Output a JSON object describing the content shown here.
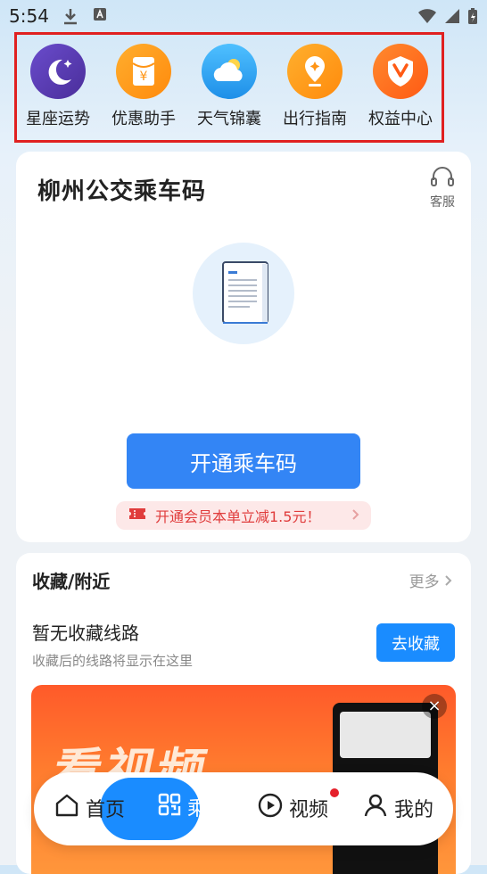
{
  "status_bar": {
    "time": "5:54"
  },
  "quick_actions": [
    {
      "label": "星座运势",
      "icon": "moon-star-icon",
      "color": "#5b3fb5"
    },
    {
      "label": "优惠助手",
      "icon": "red-envelope-icon",
      "color": "#ff9414"
    },
    {
      "label": "天气锦囊",
      "icon": "cloud-sun-icon",
      "color": "#35a7f5"
    },
    {
      "label": "出行指南",
      "icon": "location-pin-icon",
      "color": "#ff9414"
    },
    {
      "label": "权益中心",
      "icon": "vip-badge-icon",
      "color": "#ff6a1e"
    }
  ],
  "card": {
    "title": "柳州公交乘车码",
    "service_label": "客服",
    "open_button": "开通乘车码",
    "promo_text": "开通会员本单立减1.5元！"
  },
  "favorites": {
    "section_title": "收藏/附近",
    "more_label": "更多",
    "empty_title": "暂无收藏线路",
    "empty_subtitle": "收藏后的线路将显示在这里",
    "collect_button": "去收藏"
  },
  "banner": {
    "headline": "看视频"
  },
  "tabbar": {
    "home": "首页",
    "ride": "乘",
    "video": "视频",
    "mine": "我的"
  },
  "colors": {
    "accent": "#1a8cff",
    "promo_red": "#e03c3c",
    "highlight_border": "#e02020"
  }
}
